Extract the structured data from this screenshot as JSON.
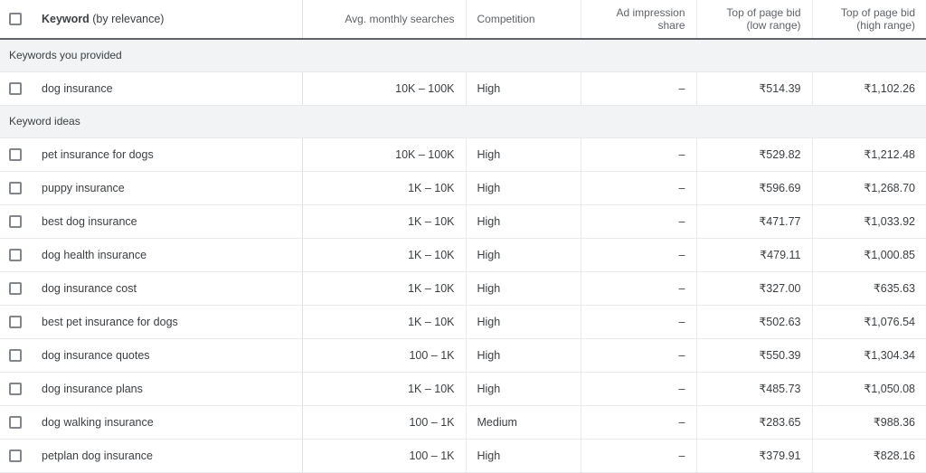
{
  "table": {
    "columns": [
      {
        "id": "checkbox",
        "label": ""
      },
      {
        "id": "keyword",
        "label_strong": "Keyword",
        "label_light": " (by relevance)"
      },
      {
        "id": "searches",
        "label": "Avg. monthly searches"
      },
      {
        "id": "competition",
        "label": "Competition"
      },
      {
        "id": "adshare",
        "label": "Ad impression share"
      },
      {
        "id": "bid_low",
        "label": "Top of page bid (low range)"
      },
      {
        "id": "bid_high",
        "label": "Top of page bid (high range)"
      }
    ],
    "sections": [
      {
        "title": "Keywords you provided",
        "rows": [
          {
            "checkbox_checked": false,
            "keyword": "dog insurance",
            "searches": "10K – 100K",
            "competition": "High",
            "adshare": "–",
            "bid_low": "₹514.39",
            "bid_high": "₹1,102.26"
          }
        ]
      },
      {
        "title": "Keyword ideas",
        "rows": [
          {
            "checkbox_checked": false,
            "keyword": "pet insurance for dogs",
            "searches": "10K – 100K",
            "competition": "High",
            "adshare": "–",
            "bid_low": "₹529.82",
            "bid_high": "₹1,212.48"
          },
          {
            "checkbox_checked": false,
            "keyword": "puppy insurance",
            "searches": "1K – 10K",
            "competition": "High",
            "adshare": "–",
            "bid_low": "₹596.69",
            "bid_high": "₹1,268.70"
          },
          {
            "checkbox_checked": false,
            "keyword": "best dog insurance",
            "searches": "1K – 10K",
            "competition": "High",
            "adshare": "–",
            "bid_low": "₹471.77",
            "bid_high": "₹1,033.92"
          },
          {
            "checkbox_checked": false,
            "keyword": "dog health insurance",
            "searches": "1K – 10K",
            "competition": "High",
            "adshare": "–",
            "bid_low": "₹479.11",
            "bid_high": "₹1,000.85"
          },
          {
            "checkbox_checked": false,
            "keyword": "dog insurance cost",
            "searches": "1K – 10K",
            "competition": "High",
            "adshare": "–",
            "bid_low": "₹327.00",
            "bid_high": "₹635.63"
          },
          {
            "checkbox_checked": false,
            "keyword": "best pet insurance for dogs",
            "searches": "1K – 10K",
            "competition": "High",
            "adshare": "–",
            "bid_low": "₹502.63",
            "bid_high": "₹1,076.54"
          },
          {
            "checkbox_checked": false,
            "keyword": "dog insurance quotes",
            "searches": "100 – 1K",
            "competition": "High",
            "adshare": "–",
            "bid_low": "₹550.39",
            "bid_high": "₹1,304.34"
          },
          {
            "checkbox_checked": false,
            "keyword": "dog insurance plans",
            "searches": "1K – 10K",
            "competition": "High",
            "adshare": "–",
            "bid_low": "₹485.73",
            "bid_high": "₹1,050.08"
          },
          {
            "checkbox_checked": false,
            "keyword": "dog walking insurance",
            "searches": "100 – 1K",
            "competition": "Medium",
            "adshare": "–",
            "bid_low": "₹283.65",
            "bid_high": "₹988.36"
          },
          {
            "checkbox_checked": false,
            "keyword": "petplan dog insurance",
            "searches": "100 – 1K",
            "competition": "High",
            "adshare": "–",
            "bid_low": "₹379.91",
            "bid_high": "₹828.16"
          }
        ]
      }
    ]
  },
  "colors": {
    "header_text": "#5f6368",
    "body_text": "#3c4043",
    "section_band": "#f1f3f4",
    "row_border": "#e8eaed",
    "header_underline": "#5f6368",
    "checkbox_border": "#80868b"
  }
}
